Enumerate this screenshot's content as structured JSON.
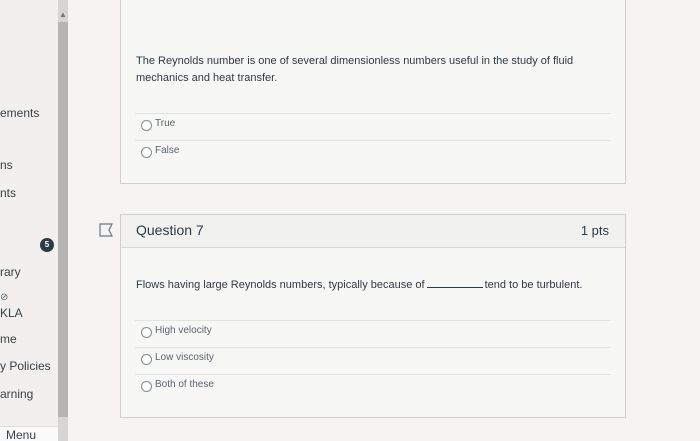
{
  "sidebar": {
    "items": [
      {
        "label": "ements"
      },
      {
        "label": "ns"
      },
      {
        "label": "nts"
      },
      {
        "label": "rary"
      },
      {
        "label": "KLA"
      },
      {
        "label": "me"
      },
      {
        "label": "y Policies"
      },
      {
        "label": "arning"
      }
    ],
    "badge": "5",
    "menu_label": "Menu"
  },
  "question6": {
    "text": "The Reynolds number is one of several dimensionless numbers useful in the study of fluid mechanics and heat transfer.",
    "answers": [
      {
        "label": "True"
      },
      {
        "label": "False"
      }
    ]
  },
  "question7": {
    "title": "Question 7",
    "points": "1 pts",
    "text_before": "Flows having large Reynolds numbers, typically because of",
    "text_after": "tend to be turbulent.",
    "answers": [
      {
        "label": "High velocity"
      },
      {
        "label": "Low viscosity"
      },
      {
        "label": "Both of these"
      }
    ]
  }
}
